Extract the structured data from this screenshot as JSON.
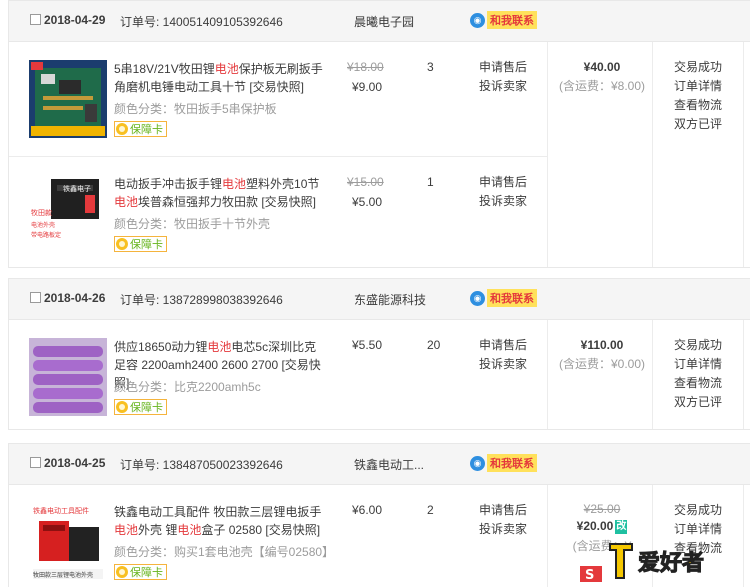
{
  "orders": [
    {
      "date": "2018-04-29",
      "order_label": "订单号: 140051409105392646",
      "shop": "晨曦电子园",
      "contact": "和我联系",
      "items": [
        {
          "title_parts": [
            "5串18V/21V牧田锂",
            "电池",
            "保护板无刷扳手角磨机电锤电动工具十节 [交易快照]"
          ],
          "sku": "颜色分类：牧田扳手5串保护板",
          "badge": "保障卡",
          "orig_price": "¥18.00",
          "price": "¥9.00",
          "qty": "3",
          "after_sales": [
            "申请售后",
            "投诉卖家"
          ]
        },
        {
          "title_parts": [
            "电动扳手冲击扳手锂",
            "电池",
            "塑料外壳10节",
            "电池",
            "埃普森恒强邦力牧田款 [交易快照]"
          ],
          "sku": "颜色分类：牧田扳手十节外壳",
          "badge": "保障卡",
          "orig_price": "¥15.00",
          "price": "¥5.00",
          "qty": "1",
          "after_sales": [
            "申请售后",
            "投诉卖家"
          ]
        }
      ],
      "total": "¥40.00",
      "shipping": "(含运费：¥8.00)",
      "status": [
        "交易成功",
        "订单详情",
        "查看物流",
        "双方已评"
      ]
    },
    {
      "date": "2018-04-26",
      "order_label": "订单号: 138728998038392646",
      "shop": "东盛能源科技",
      "contact": "和我联系",
      "items": [
        {
          "title_parts": [
            "供应18650动力锂",
            "电池",
            "电芯5c深圳比克足容 2200amh2400 2600 2700 [交易快照]"
          ],
          "sku": "颜色分类：比克2200amh5c",
          "badge": "保障卡",
          "orig_price": "",
          "price": "¥5.50",
          "qty": "20",
          "after_sales": [
            "申请售后",
            "投诉卖家"
          ]
        }
      ],
      "total": "¥110.00",
      "shipping": "(含运费：¥0.00)",
      "status": [
        "交易成功",
        "订单详情",
        "查看物流",
        "双方已评"
      ]
    },
    {
      "date": "2018-04-25",
      "order_label": "订单号: 138487050023392646",
      "shop": "铁鑫电动工...",
      "contact": "和我联系",
      "items": [
        {
          "title_parts": [
            "铁鑫电动工具配件 牧田款三层锂电扳手",
            "电池",
            "外壳 锂",
            "电池",
            "盒子 02580 [交易快照]"
          ],
          "sku": "颜色分类：购买1套电池壳【编号02580】",
          "badge": "保障卡",
          "orig_price": "",
          "price": "¥6.00",
          "qty": "2",
          "after_sales": [
            "申请售后",
            "投诉卖家"
          ]
        }
      ],
      "total_orig": "¥25.00",
      "total": "¥20.00",
      "total_tag": "改",
      "shipping": "(含运费：¥",
      "status": [
        "交易成功",
        "订单详情",
        "查看物流"
      ]
    }
  ],
  "watermark": "爱好者",
  "colors": {
    "highlight": "#e4393c",
    "header_bg": "#f5f5f5",
    "contact_bg": "#ffe15b",
    "badge_green": "#67b51e"
  },
  "icons": [
    "checkbox-icon",
    "wangwang-icon",
    "shield-badge-icon"
  ]
}
